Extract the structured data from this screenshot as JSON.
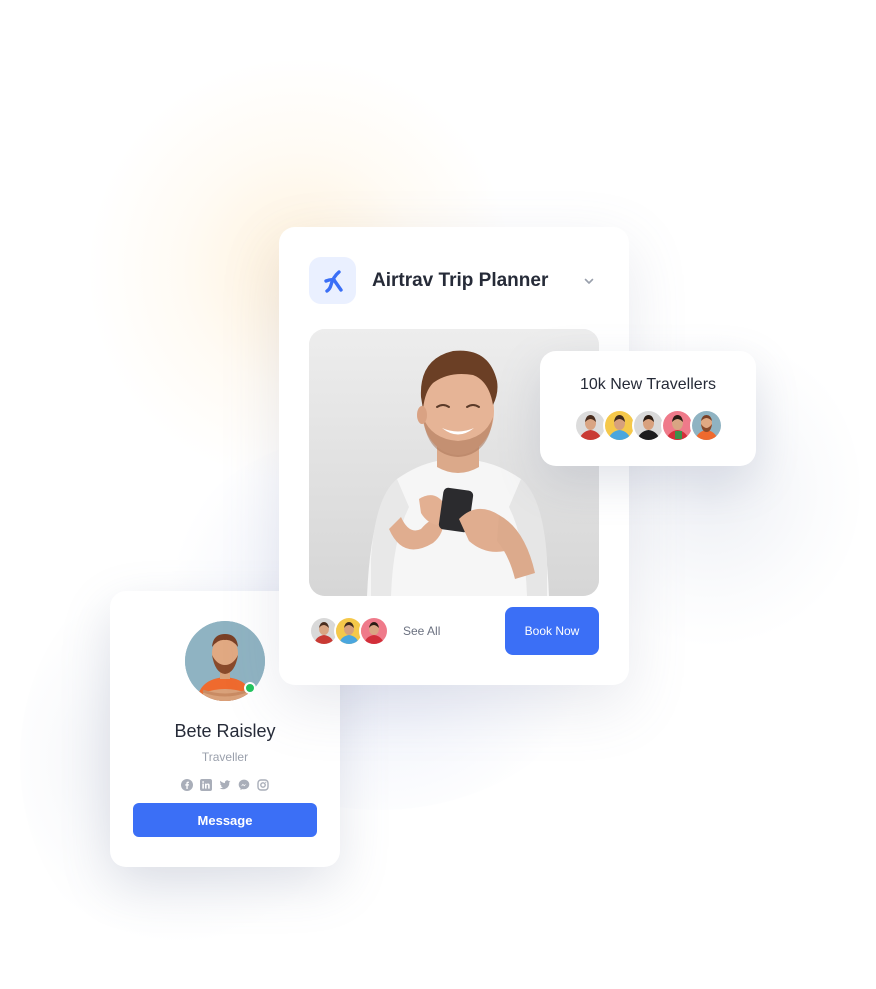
{
  "main_card": {
    "title": "Airtrav Trip Planner",
    "logo_icon": "airtrav-logo-icon",
    "chevron_icon": "chevron-down-icon",
    "hero_image": "man-smiling-at-phone-photo",
    "see_all_label": "See All",
    "book_label": "Book Now"
  },
  "travellers_card": {
    "title": "10k New Travellers",
    "avatars": [
      "red-shirt",
      "blue-shirt",
      "black-shirt",
      "red-green-shirt",
      "orange-shirt"
    ]
  },
  "profile_card": {
    "name": "Bete Raisley",
    "role": "Traveller",
    "online": true,
    "socials": [
      "facebook-icon",
      "linkedin-icon",
      "twitter-icon",
      "messenger-icon",
      "instagram-icon"
    ],
    "message_label": "Message"
  },
  "colors": {
    "accent": "#3b6ff6",
    "logo_bg": "#eaf0ff",
    "online": "#22c55e",
    "title_text": "#262b38",
    "muted_text": "#9aa0ac"
  }
}
